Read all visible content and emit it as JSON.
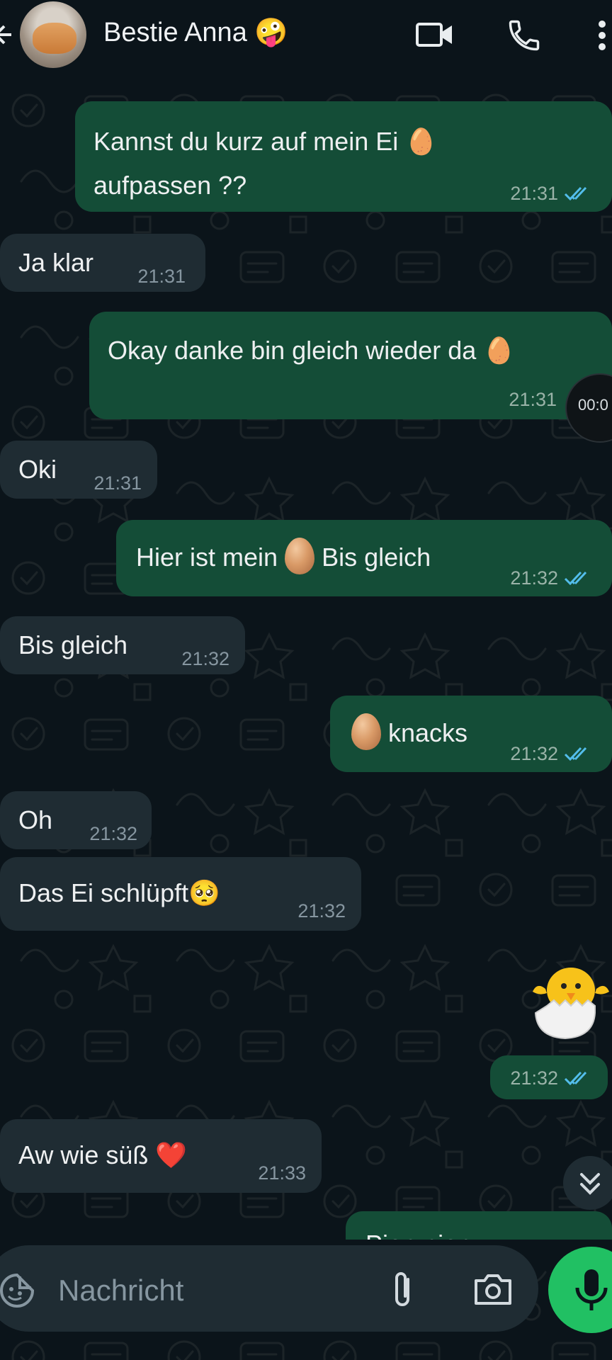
{
  "header": {
    "contact_name": "Bestie Anna 🤪",
    "icons": [
      "back-arrow-icon",
      "avatar",
      "video-call-icon",
      "voice-call-icon",
      "more-vert-icon"
    ]
  },
  "messages": [
    {
      "dir": "out",
      "lines": [
        "Kannst du kurz auf mein Ei 🥚",
        "aufpassen ??"
      ],
      "time": "21:31",
      "status": "read"
    },
    {
      "dir": "in",
      "text": "Ja klar",
      "time": "21:31"
    },
    {
      "dir": "out",
      "text": "Okay danke bin gleich wieder da 🥚",
      "time": "21:31",
      "status": "read"
    },
    {
      "dir": "in",
      "text": "Oki",
      "time": "21:31"
    },
    {
      "dir": "out",
      "text_before": "Hier ist mein",
      "emoji": "🥚",
      "text_after": "Bis gleich",
      "time": "21:32",
      "status": "read"
    },
    {
      "dir": "in",
      "text": "Bis gleich",
      "time": "21:32"
    },
    {
      "dir": "out",
      "emoji": "🥚",
      "text": "knacks",
      "time": "21:32",
      "status": "read"
    },
    {
      "dir": "in",
      "text": "Oh",
      "time": "21:32"
    },
    {
      "dir": "in",
      "text": "Das Ei schlüpft🥺",
      "time": "21:32"
    },
    {
      "dir": "out",
      "sticker": "🐣",
      "time": "21:32",
      "status": "read"
    },
    {
      "dir": "in",
      "text": "Aw wie süß ❤️",
      "time": "21:33"
    },
    {
      "dir": "out",
      "text": "Piep piep",
      "partial": true
    }
  ],
  "overlays": {
    "media_timer": "00:0",
    "scroll_button": "double-chevron-down-icon"
  },
  "composer": {
    "placeholder": "Nachricht",
    "icons": [
      "sticker-icon",
      "attach-icon",
      "camera-icon",
      "mic-icon"
    ]
  },
  "colors": {
    "background": "#0b141a",
    "outgoing_bubble": "#144d37",
    "incoming_bubble": "#1f2c33",
    "read_ticks": "#53bdeb",
    "mic_button": "#21c063"
  }
}
